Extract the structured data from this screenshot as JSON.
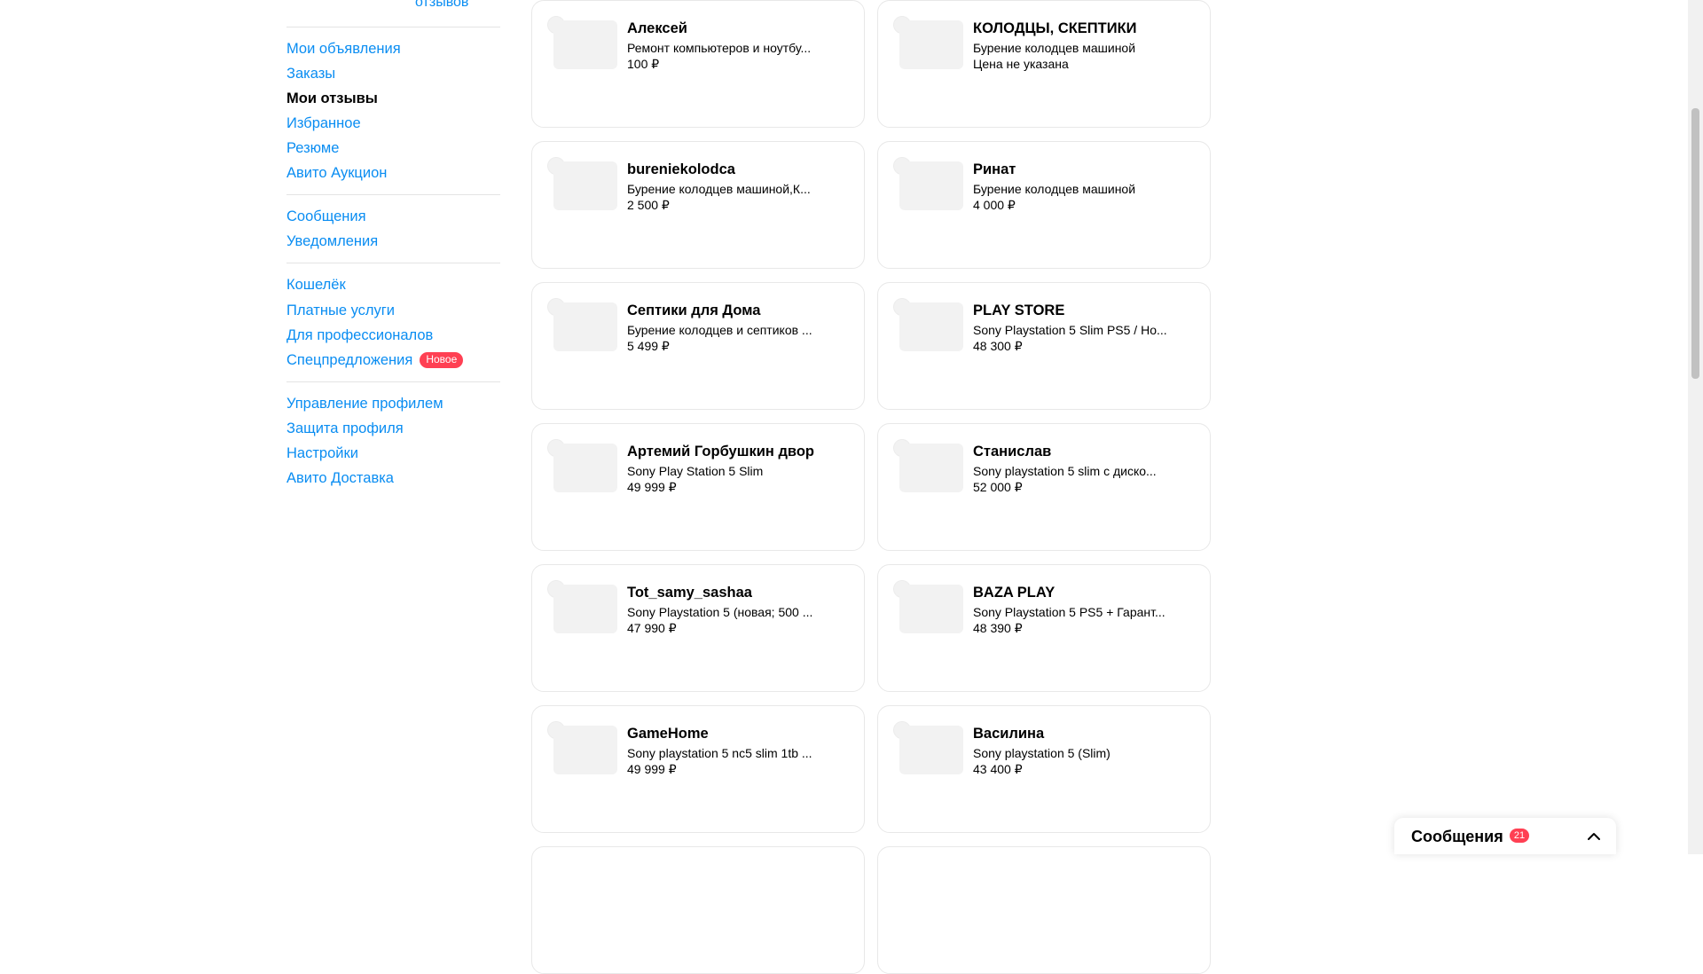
{
  "sidebar": {
    "reviews_link": "отзывов",
    "groups": [
      {
        "items": [
          {
            "label": "Мои объявления"
          },
          {
            "label": "Заказы"
          },
          {
            "label": "Мои отзывы",
            "active": true
          },
          {
            "label": "Избранное"
          },
          {
            "label": "Резюме"
          },
          {
            "label": "Авито Аукцион"
          }
        ]
      },
      {
        "items": [
          {
            "label": "Сообщения"
          },
          {
            "label": "Уведомления"
          }
        ]
      },
      {
        "items": [
          {
            "label": "Кошелёк"
          },
          {
            "label": "Платные услуги"
          },
          {
            "label": "Для профессионалов"
          },
          {
            "label": "Спецпредложения",
            "badge": "Новое"
          }
        ]
      },
      {
        "items": [
          {
            "label": "Управление профилем"
          },
          {
            "label": "Защита профиля"
          },
          {
            "label": "Настройки"
          },
          {
            "label": "Авито Доставка"
          }
        ]
      }
    ]
  },
  "cards": [
    {
      "name": "Алексей",
      "desc": "Ремонт компьютеров и ноутбу...",
      "price": "100 ₽"
    },
    {
      "name": "КОЛОДЦЫ, СКЕПТИКИ",
      "desc": "Бурение колодцев машиной",
      "price": "Цена не указана"
    },
    {
      "name": "bureniekolodca",
      "desc": "Бурение колодцев машиной,К...",
      "price": "2 500 ₽"
    },
    {
      "name": "Ринат",
      "desc": "Бурение колодцев машиной",
      "price": "4 000 ₽"
    },
    {
      "name": "Септики для Дома",
      "desc": "Бурение колодцев и септиков ...",
      "price": "5 499 ₽"
    },
    {
      "name": "PLAY STORE",
      "desc": "Sony Playstation 5 Slim PS5 / Но...",
      "price": "48 300 ₽"
    },
    {
      "name": "Артемий Горбушкин двор",
      "desc": "Sony Play Station 5 Slim",
      "price": "49 999 ₽"
    },
    {
      "name": "Станислав",
      "desc": "Sony playstation 5 slim с диско...",
      "price": "52 000 ₽"
    },
    {
      "name": "Tot_samy_sashaa",
      "desc": "Sony Playstation 5 (новая; 500 ...",
      "price": "47 990 ₽"
    },
    {
      "name": "BAZA PLAY",
      "desc": "Sony Playstation 5 PS5 + Гарант...",
      "price": "48 390 ₽"
    },
    {
      "name": "GameHome",
      "desc": "Sony playstation 5 nc5 slim 1tb ...",
      "price": "49 999 ₽"
    },
    {
      "name": "Василина",
      "desc": "Sony playstation 5 (Slim)",
      "price": "43 400 ₽"
    }
  ],
  "messages_widget": {
    "title": "Сообщения",
    "count": "21",
    "chevron_icon": "chevron-up-icon"
  },
  "colors": {
    "link": "#0a8df2",
    "badge": "#ff4053"
  }
}
